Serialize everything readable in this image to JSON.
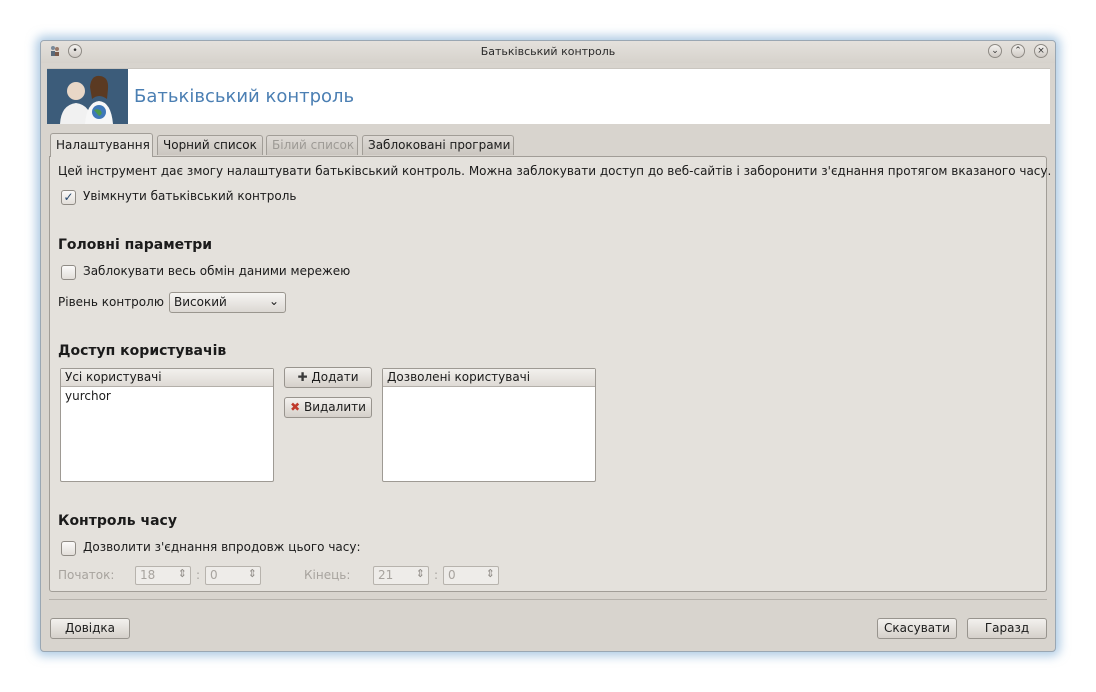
{
  "window": {
    "title": "Батьківський контроль"
  },
  "banner": {
    "title": "Батьківський контроль"
  },
  "tabs": [
    {
      "label": "Налаштування",
      "state": "active"
    },
    {
      "label": "Чорний список",
      "state": "normal"
    },
    {
      "label": "Білий список",
      "state": "disabled"
    },
    {
      "label": "Заблоковані програми",
      "state": "normal"
    }
  ],
  "settings": {
    "description": "Цей інструмент дає змогу налаштувати батьківський контроль. Можна заблокувати доступ до веб-сайтів і заборонити з'єднання протягом вказаного часу.",
    "enable_label": "Увімкнути батьківський контроль",
    "enable_checked": true
  },
  "main_params": {
    "heading": "Головні параметри",
    "block_all_label": "Заблокувати весь обмін даними мережею",
    "block_all_checked": false,
    "level_label": "Рівень контролю",
    "level_value": "Високий"
  },
  "user_access": {
    "heading": "Доступ користувачів",
    "all_users_header": "Усі користувачі",
    "all_users": [
      "yurchor"
    ],
    "add_label": "Додати",
    "remove_label": "Видалити",
    "allowed_users_header": "Дозволені користувачі",
    "allowed_users": []
  },
  "time_control": {
    "heading": "Контроль часу",
    "allow_label": "Дозволити з'єднання впродовж цього часу:",
    "allow_checked": false,
    "start_label": "Початок:",
    "start_hour": "18",
    "start_minute": "0",
    "end_label": "Кінець:",
    "end_hour": "21",
    "end_minute": "0",
    "separator": ":"
  },
  "footer": {
    "help_label": "Довідка",
    "cancel_label": "Скасувати",
    "ok_label": "Гаразд"
  },
  "icons": {
    "app_icon": "family-icon",
    "add_icon": "plus-icon",
    "remove_icon": "x-icon",
    "check_mark": "✓"
  }
}
